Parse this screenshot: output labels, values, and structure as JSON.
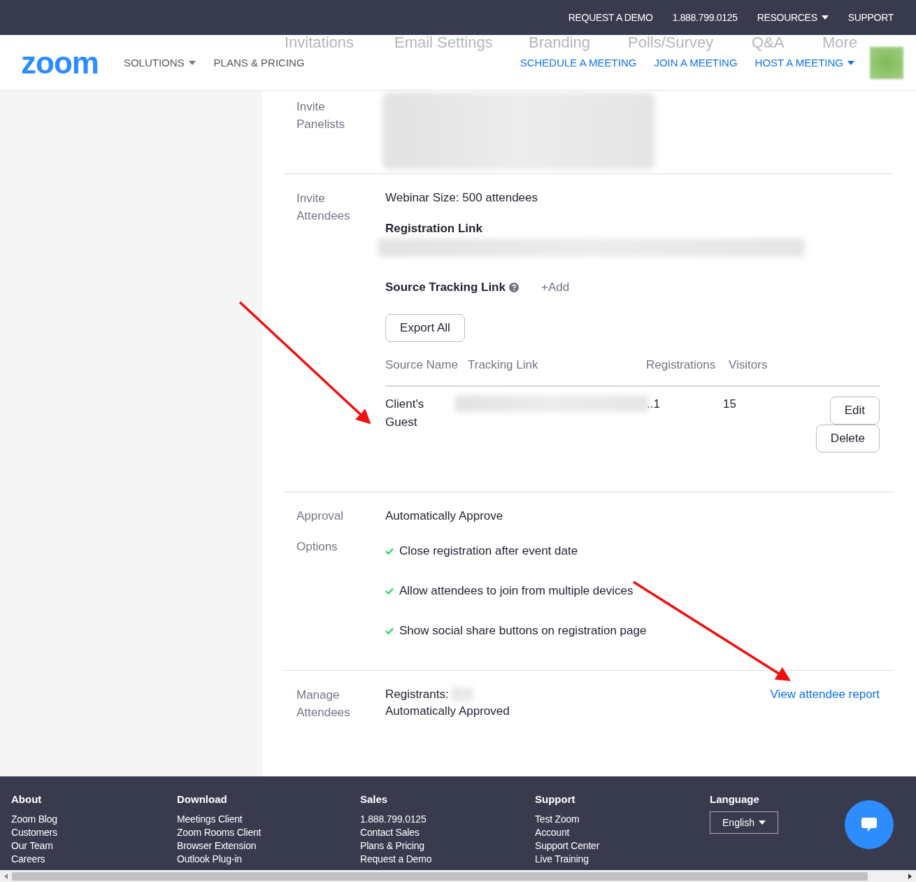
{
  "top_bar": {
    "links": [
      {
        "label": "REQUEST A DEMO",
        "dropdown": false
      },
      {
        "label": "1.888.799.0125",
        "dropdown": false
      },
      {
        "label": "RESOURCES",
        "dropdown": true
      },
      {
        "label": "SUPPORT",
        "dropdown": false
      }
    ]
  },
  "header": {
    "logo": "zoom",
    "nav_left": [
      {
        "label": "SOLUTIONS",
        "dropdown": true
      },
      {
        "label": "PLANS & PRICING",
        "dropdown": false
      }
    ],
    "background_tabs": [
      "Invitations",
      "Email Settings",
      "Branding",
      "Polls/Survey",
      "Q&A",
      "More"
    ],
    "nav_right": [
      {
        "label": "SCHEDULE A MEETING",
        "dropdown": false
      },
      {
        "label": "JOIN A MEETING",
        "dropdown": false
      },
      {
        "label": "HOST A MEETING",
        "dropdown": true
      }
    ]
  },
  "sections": [
    {
      "kind": "blurred",
      "label": "Invite Panelists"
    },
    {
      "kind": "attendees",
      "label": "Invite Attendees",
      "size_text": "Webinar Size: 500 attendees",
      "registration_link_label": "Registration Link",
      "tracking_label": "Source Tracking Link",
      "add_label": "+Add",
      "export_button": "Export All",
      "columns": [
        "Source Name",
        "Tracking Link",
        "Registrations",
        "Visitors"
      ],
      "rows": [
        {
          "source": "Client's Guest",
          "link_tail": "..1",
          "visitors": "15",
          "actions": [
            "Edit",
            "Delete"
          ]
        }
      ]
    },
    {
      "kind": "options",
      "label": "Approval Options",
      "approval": "Automatically Approve",
      "options": [
        {
          "text": "Close registration after event date",
          "checked": true
        },
        {
          "text": "Allow attendees to join from multiple devices",
          "checked": true
        },
        {
          "text": "Show social share buttons on registration page",
          "checked": true
        }
      ]
    },
    {
      "kind": "manage",
      "label": "Manage Attendees",
      "registrants_label": "Registrants:",
      "status": "Automatically Approved",
      "report_link": "View attendee report"
    }
  ],
  "footer": {
    "columns": [
      {
        "heading": "About",
        "items": [
          "Zoom Blog",
          "Customers",
          "Our Team",
          "Careers"
        ]
      },
      {
        "heading": "Download",
        "items": [
          "Meetings Client",
          "Zoom Rooms Client",
          "Browser Extension",
          "Outlook Plug-in"
        ]
      },
      {
        "heading": "Sales",
        "items": [
          "1.888.799.0125",
          "Contact Sales",
          "Plans & Pricing",
          "Request a Demo"
        ]
      },
      {
        "heading": "Support",
        "items": [
          "Test Zoom",
          "Account",
          "Support Center",
          "Live Training"
        ]
      }
    ],
    "language_heading": "Language",
    "language": "English"
  }
}
